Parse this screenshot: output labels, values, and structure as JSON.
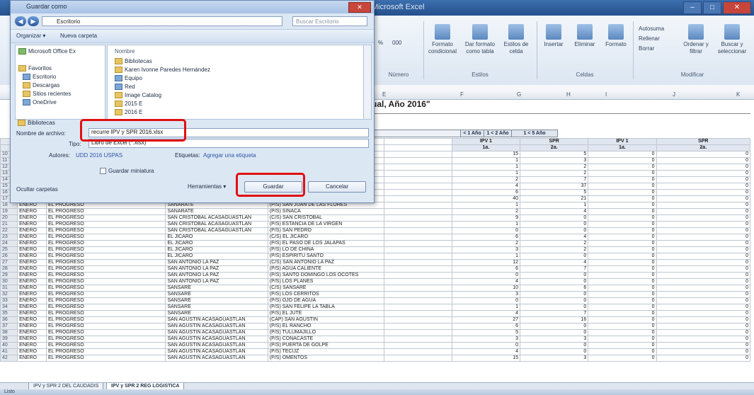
{
  "excel": {
    "title_bar": "Microsoft Excel",
    "ribbon_groups": [
      {
        "label": "Número",
        "buttons": [
          "%",
          "000"
        ]
      },
      {
        "label": "Estilos",
        "buttons": [
          "Formato condicional",
          "Dar formato como tabla",
          "Estilos de celda"
        ]
      },
      {
        "label": "Celdas",
        "buttons": [
          "Insertar",
          "Eliminar",
          "Formato"
        ]
      },
      {
        "label": "Modificar",
        "buttons": [
          "Autosuma",
          "Rellenar",
          "Borrar",
          "Ordenar y filtrar",
          "Buscar y seleccionar"
        ]
      }
    ],
    "column_letters": [
      "E",
      "F",
      "G",
      "H",
      "I",
      "J",
      "K"
    ],
    "heading": "ual, Año 2016\"",
    "header_groups": [
      "< 1 Año",
      "1 < 2 Año",
      "1 < 5 Año"
    ],
    "header_sub": [
      "IPV 1",
      "SPR",
      "IPV 1",
      "SPR"
    ],
    "header_doses": [
      "1a.",
      "2a.",
      "1a.",
      "2a."
    ],
    "rows": [
      {
        "n": "10",
        "mes": "",
        "dep": "",
        "mun": "",
        "lugar": "",
        "v": [
          "15",
          "5",
          "0",
          "0"
        ]
      },
      {
        "n": "11",
        "mes": "",
        "dep": "",
        "mun": "",
        "lugar": "",
        "v": [
          "1",
          "3",
          "0",
          "0"
        ]
      },
      {
        "n": "12",
        "mes": "",
        "dep": "",
        "mun": "",
        "lugar": "",
        "v": [
          "1",
          "2",
          "0",
          "0"
        ]
      },
      {
        "n": "13",
        "mes": "",
        "dep": "",
        "mun": "",
        "lugar": "",
        "v": [
          "1",
          "2",
          "0",
          "0"
        ]
      },
      {
        "n": "14",
        "mes": "",
        "dep": "",
        "mun": "",
        "lugar": "",
        "v": [
          "2",
          "7",
          "0",
          "0"
        ]
      },
      {
        "n": "15",
        "mes": "",
        "dep": "",
        "mun": "",
        "lugar": "",
        "v": [
          "4",
          "37",
          "0",
          "0"
        ]
      },
      {
        "n": "16",
        "mes": "ENERO",
        "dep": "EL PROGRESO",
        "mun": "GUASTATOYA",
        "lugar": "(P/S) EL NARANJO",
        "v": [
          "6",
          "5",
          "0",
          "0"
        ]
      },
      {
        "n": "17",
        "mes": "ENERO",
        "dep": "EL PROGRESO",
        "mun": "SANARATE",
        "lugar": "(CAP) SANARATE",
        "v": [
          "40",
          "21",
          "0",
          "0"
        ]
      },
      {
        "n": "18",
        "mes": "ENERO",
        "dep": "EL PROGRESO",
        "mun": "SANARATE",
        "lugar": "(P/S) SAN JUAN DE LAS FLORES",
        "v": [
          "1",
          "1",
          "0",
          "0"
        ]
      },
      {
        "n": "19",
        "mes": "ENERO",
        "dep": "EL PROGRESO",
        "mun": "SANARATE",
        "lugar": "(P/S) SINACA",
        "v": [
          "2",
          "4",
          "0",
          "0"
        ]
      },
      {
        "n": "20",
        "mes": "ENERO",
        "dep": "EL PROGRESO",
        "mun": "SAN CRISTOBAL ACASAGUASTLAN",
        "lugar": "(C/S) SAN CRISTOBAL",
        "v": [
          "9",
          "0",
          "0",
          "0"
        ]
      },
      {
        "n": "21",
        "mes": "ENERO",
        "dep": "EL PROGRESO",
        "mun": "SAN CRISTOBAL ACASAGUASTLAN",
        "lugar": "(P/S) ESTANCIA DE LA VIRGEN",
        "v": [
          "1",
          "0",
          "0",
          "0"
        ]
      },
      {
        "n": "22",
        "mes": "ENERO",
        "dep": "EL PROGRESO",
        "mun": "SAN CRISTOBAL ACASAGUASTLAN",
        "lugar": "(P/S) SAN PEDRO",
        "v": [
          "0",
          "0",
          "0",
          "0"
        ]
      },
      {
        "n": "23",
        "mes": "ENERO",
        "dep": "EL PROGRESO",
        "mun": "EL JICARO",
        "lugar": "(C/S) EL JICARO",
        "v": [
          "6",
          "4",
          "0",
          "0"
        ]
      },
      {
        "n": "24",
        "mes": "ENERO",
        "dep": "EL PROGRESO",
        "mun": "EL JICARO",
        "lugar": "(P/S) EL PASO DE LOS JALAPAS",
        "v": [
          "2",
          "2",
          "0",
          "0"
        ]
      },
      {
        "n": "25",
        "mes": "ENERO",
        "dep": "EL PROGRESO",
        "mun": "EL JICARO",
        "lugar": "(P/S) LO DE CHINA",
        "v": [
          "3",
          "2",
          "0",
          "0"
        ]
      },
      {
        "n": "26",
        "mes": "ENERO",
        "dep": "EL PROGRESO",
        "mun": "EL JICARO",
        "lugar": "(P/S) ESPIRITU SANTO",
        "v": [
          "1",
          "0",
          "0",
          "0"
        ]
      },
      {
        "n": "27",
        "mes": "ENERO",
        "dep": "EL PROGRESO",
        "mun": "SAN ANTONIO LA PAZ",
        "lugar": "(C/S) SAN ANTONIO LA PAZ",
        "v": [
          "12",
          "4",
          "0",
          "0"
        ]
      },
      {
        "n": "28",
        "mes": "ENERO",
        "dep": "EL PROGRESO",
        "mun": "SAN ANTONIO LA PAZ",
        "lugar": "(P/S) AGUA CALIENTE",
        "v": [
          "6",
          "7",
          "0",
          "0"
        ]
      },
      {
        "n": "29",
        "mes": "ENERO",
        "dep": "EL PROGRESO",
        "mun": "SAN ANTONIO LA PAZ",
        "lugar": "(P/S) SANTO DOMINGO LOS OCOTES",
        "v": [
          "0",
          "0",
          "0",
          "0"
        ]
      },
      {
        "n": "30",
        "mes": "ENERO",
        "dep": "EL PROGRESO",
        "mun": "SAN ANTONIO LA PAZ",
        "lugar": "(P/S) LOS PLANES",
        "v": [
          "4",
          "0",
          "0",
          "0"
        ]
      },
      {
        "n": "31",
        "mes": "ENERO",
        "dep": "EL PROGRESO",
        "mun": "SANSARE",
        "lugar": "(C/S) SANSARE",
        "v": [
          "10",
          "6",
          "0",
          "0"
        ]
      },
      {
        "n": "32",
        "mes": "ENERO",
        "dep": "EL PROGRESO",
        "mun": "SANSARE",
        "lugar": "(P/S) LOS CERRITOS",
        "v": [
          "3",
          "0",
          "0",
          "0"
        ]
      },
      {
        "n": "33",
        "mes": "ENERO",
        "dep": "EL PROGRESO",
        "mun": "SANSARE",
        "lugar": "(P/S) OJO DE AGUA",
        "v": [
          "0",
          "0",
          "0",
          "0"
        ]
      },
      {
        "n": "34",
        "mes": "ENERO",
        "dep": "EL PROGRESO",
        "mun": "SANSARE",
        "lugar": "(P/S) SAN FELIPE LA TABLA",
        "v": [
          "1",
          "0",
          "0",
          "0"
        ]
      },
      {
        "n": "35",
        "mes": "ENERO",
        "dep": "EL PROGRESO",
        "mun": "SANSARE",
        "lugar": "(P/S) EL JUTE",
        "v": [
          "4",
          "7",
          "0",
          "0"
        ]
      },
      {
        "n": "36",
        "mes": "ENERO",
        "dep": "EL PROGRESO",
        "mun": "SAN AGUSTIN ACASAGUASTLAN",
        "lugar": "(CAP) SAN AGUSTIN",
        "v": [
          "27",
          "16",
          "0",
          "0"
        ]
      },
      {
        "n": "37",
        "mes": "ENERO",
        "dep": "EL PROGRESO",
        "mun": "SAN AGUSTIN ACASAGUASTLAN",
        "lugar": "(P/S) EL RANCHO",
        "v": [
          "6",
          "0",
          "0",
          "0"
        ]
      },
      {
        "n": "38",
        "mes": "ENERO",
        "dep": "EL PROGRESO",
        "mun": "SAN AGUSTIN ACASAGUASTLAN",
        "lugar": "(P/S) TULUMAJILLO",
        "v": [
          "5",
          "0",
          "0",
          "0"
        ]
      },
      {
        "n": "39",
        "mes": "ENERO",
        "dep": "EL PROGRESO",
        "mun": "SAN AGUSTIN ACASAGUASTLAN",
        "lugar": "(P/S) CONACASTE",
        "v": [
          "3",
          "3",
          "0",
          "0"
        ]
      },
      {
        "n": "40",
        "mes": "ENERO",
        "dep": "EL PROGRESO",
        "mun": "SAN AGUSTIN ACASAGUASTLAN",
        "lugar": "(P/S) PUERTA DE GOLPE",
        "v": [
          "0",
          "0",
          "0",
          "0"
        ]
      },
      {
        "n": "41",
        "mes": "ENERO",
        "dep": "EL PROGRESO",
        "mun": "SAN AGUSTIN ACASAGUASTLAN",
        "lugar": "(P/S) TECIJZ",
        "v": [
          "4",
          "0",
          "0",
          "0"
        ]
      },
      {
        "n": "42",
        "mes": "ENERO",
        "dep": "EL PROGRESO",
        "mun": "SAN AGUSTIN ACASAGUASTLAN",
        "lugar": "(P/S) OMENTOS",
        "v": [
          "15",
          "3",
          "0",
          "0"
        ]
      }
    ],
    "tabs": [
      "IPV y SPR 2 DEL CAUDADIS",
      "IPV y SPR 2 REG LOGISTICA"
    ],
    "status": "Listo"
  },
  "dialog": {
    "title": "Guardar como",
    "address_path": "Escritorio",
    "search_placeholder": "Buscar Escritorio",
    "toolbar_organize": "Organizar ▾",
    "toolbar_new_folder": "Nueva carpeta",
    "nav_items": [
      "Microsoft Office Ex",
      "Favoritos",
      "Escritorio",
      "Descargas",
      "Sitios recientes",
      "OneDrive",
      "Bibliotecas"
    ],
    "content_header": "Nombre",
    "content_items": [
      "Bibliotecas",
      "Karen Ivonne Paredes Hernández",
      "Equipo",
      "Red",
      "Image Catalog",
      "2015 E",
      "2016 E"
    ],
    "filename_label": "Nombre de archivo:",
    "filename_value": "recurre IPV y SPR 2016.xlsx",
    "type_label": "Tipo:",
    "type_value": "Libro de Excel (*.xlsx)",
    "authors_label": "Autores:",
    "authors_value": "UDD 2016 USPAS",
    "tags_label": "Etiquetas:",
    "tags_value": "Agregar una etiqueta",
    "thumbnail_label": "Guardar miniatura",
    "hide_folders": "Ocultar carpetas",
    "tools_label": "Herramientas ▾",
    "save_button": "Guardar",
    "cancel_button": "Cancelar"
  },
  "highlight_color": "#e01010"
}
